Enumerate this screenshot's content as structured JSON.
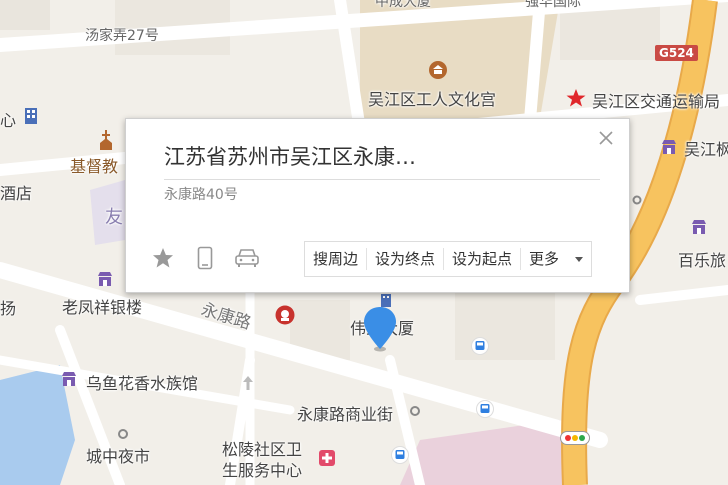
{
  "popup": {
    "title": "江苏省苏州市吴江区永康…",
    "address": "永康路40号",
    "actions": {
      "nearby": "搜周边",
      "set_end": "设为终点",
      "set_start": "设为起点",
      "more": "更多"
    }
  },
  "map": {
    "highway_badge": "G524",
    "labels": {
      "top_clipped_1": "中成大厦",
      "top_clipped_2": "强华国际",
      "tangjia": "汤家弄27号",
      "culture_palace": "吴江区工人文化宫",
      "transport_bureau": "吴江区交通运输局",
      "left_xin": "心",
      "church": "基督教",
      "hotel": "酒店",
      "wujiang_right": "吴江枫",
      "you": "友",
      "baile": "百乐旅",
      "yang": "扬",
      "laofengxiang": "老凤祥银楼",
      "yongkang_road": "永康路",
      "weiye": "伟业大厦",
      "aquarium": "乌鱼花香水族馆",
      "yongkang_street": "永康路商业街",
      "night_market": "城中夜市",
      "clinic_1": "松陵社区卫",
      "clinic_2": "生服务中心"
    }
  },
  "colors": {
    "highway": "#f7c35f",
    "highway_edge": "#e8a94a",
    "pin": "#3a8ee6",
    "building": "#e8dcc4",
    "water": "#a9cbee",
    "purple_block": "#e4dfec",
    "pink_block": "#ead1dc"
  }
}
